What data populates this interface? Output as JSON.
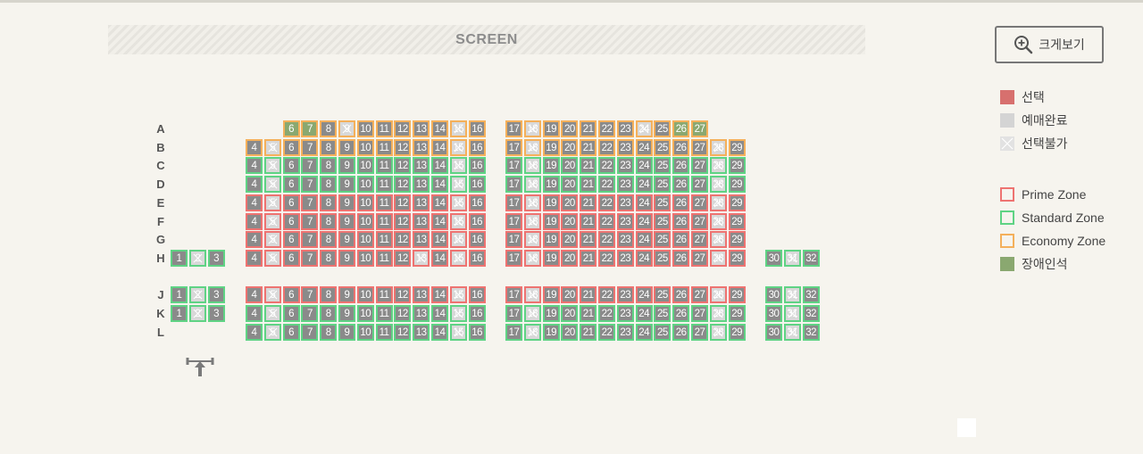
{
  "screen_label": "SCREEN",
  "zoom_button": {
    "label": "크게보기",
    "icon": "zoom-in-icon"
  },
  "legend_status": [
    {
      "label": "선택",
      "key": "selected",
      "color": "#d7706e"
    },
    {
      "label": "예매완료",
      "key": "sold",
      "color": "#d4d4d4"
    },
    {
      "label": "선택불가",
      "key": "unavailable",
      "color": "#e2e2e2"
    }
  ],
  "legend_zones": [
    {
      "label": "Prime Zone",
      "key": "prime",
      "color": "#ee7371"
    },
    {
      "label": "Standard Zone",
      "key": "standard",
      "color": "#5fd384"
    },
    {
      "label": "Economy Zone",
      "key": "economy",
      "color": "#f4b05b"
    },
    {
      "label": "장애인석",
      "key": "disabled",
      "color": "#8aa870"
    }
  ],
  "rows": [
    {
      "label": "A",
      "zone": "economy",
      "blocks": [
        [
          6,
          16
        ],
        [
          17,
          27
        ]
      ],
      "disabled": [
        6,
        7,
        26,
        27
      ],
      "unavailable": [
        9,
        15,
        18,
        24
      ]
    },
    {
      "label": "B",
      "zone": "economy",
      "blocks": [
        [
          4,
          16
        ],
        [
          17,
          29
        ]
      ],
      "unavailable": [
        5,
        15,
        18,
        28
      ]
    },
    {
      "label": "C",
      "zone": "standard",
      "blocks": [
        [
          4,
          16
        ],
        [
          17,
          29
        ]
      ],
      "unavailable": [
        5,
        15,
        18,
        28
      ]
    },
    {
      "label": "D",
      "zone": "standard",
      "blocks": [
        [
          4,
          16
        ],
        [
          17,
          29
        ]
      ],
      "unavailable": [
        5,
        15,
        18,
        28
      ]
    },
    {
      "label": "E",
      "zone": "prime",
      "blocks": [
        [
          4,
          16
        ],
        [
          17,
          29
        ]
      ],
      "unavailable": [
        5,
        15,
        18,
        28
      ]
    },
    {
      "label": "F",
      "zone": "prime",
      "blocks": [
        [
          4,
          16
        ],
        [
          17,
          29
        ]
      ],
      "unavailable": [
        5,
        15,
        18,
        28
      ]
    },
    {
      "label": "G",
      "zone": "prime",
      "blocks": [
        [
          4,
          16
        ],
        [
          17,
          29
        ]
      ],
      "unavailable": [
        5,
        15,
        18,
        28
      ]
    },
    {
      "label": "H",
      "zone": "prime",
      "blocks": [
        [
          1,
          3
        ],
        [
          4,
          16
        ],
        [
          17,
          29
        ],
        [
          30,
          32
        ]
      ],
      "unavailable": [
        2,
        5,
        13,
        15,
        18,
        28,
        31
      ],
      "green_seats": [
        1,
        2,
        3,
        30,
        31,
        32
      ]
    },
    {
      "label": "J",
      "zone": "prime",
      "blocks": [
        [
          1,
          3
        ],
        [
          4,
          16
        ],
        [
          17,
          29
        ],
        [
          30,
          32
        ]
      ],
      "unavailable": [
        2,
        5,
        15,
        18,
        28,
        31
      ],
      "green_seats": [
        1,
        2,
        3,
        30,
        31,
        32
      ]
    },
    {
      "label": "K",
      "zone": "standard",
      "blocks": [
        [
          1,
          3
        ],
        [
          4,
          16
        ],
        [
          17,
          29
        ],
        [
          30,
          32
        ]
      ],
      "unavailable": [
        2,
        5,
        15,
        18,
        28,
        31
      ]
    },
    {
      "label": "L",
      "zone": "standard",
      "blocks": [
        [
          4,
          16
        ],
        [
          17,
          29
        ],
        [
          30,
          32
        ]
      ],
      "unavailable": [
        5,
        15,
        18,
        28,
        31
      ]
    }
  ]
}
